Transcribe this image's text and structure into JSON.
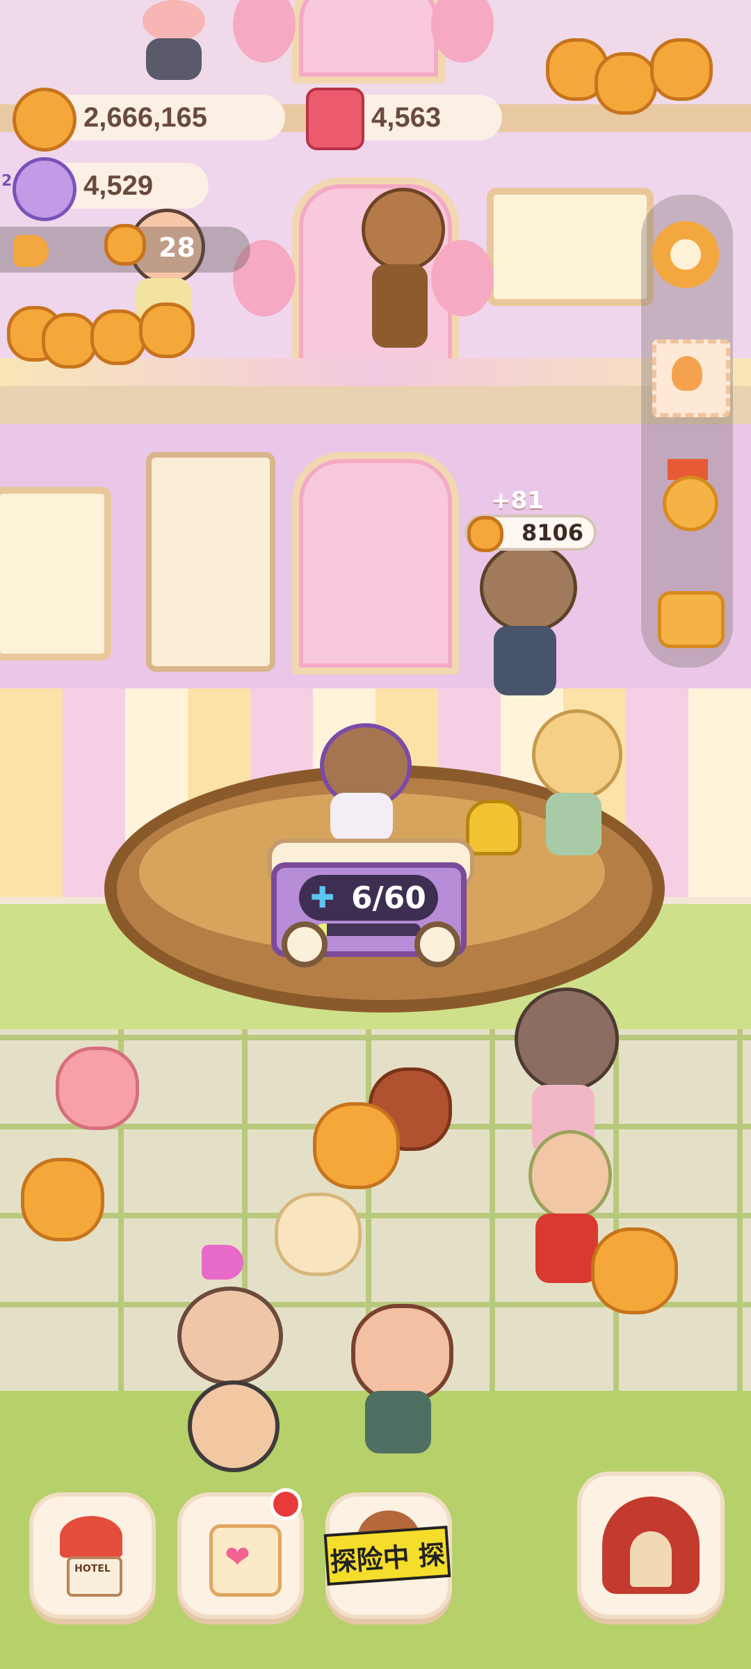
{
  "hud": {
    "cookies": "2,666,165",
    "candles": "4,563",
    "gems": "4,529",
    "gems_level": "2",
    "visitors": "28"
  },
  "shop": {
    "income_popup": "+81",
    "coin_value": "8106"
  },
  "cart": {
    "capacity": "6/60",
    "fill_fraction": 0.1
  },
  "bottom_nav": {
    "hotel_label": "HOTEL",
    "explore_tag": "探险中 探"
  },
  "colors": {
    "accent": "#f5a73a",
    "badge": "#e83a3a",
    "explore": "#f5dd2b"
  }
}
